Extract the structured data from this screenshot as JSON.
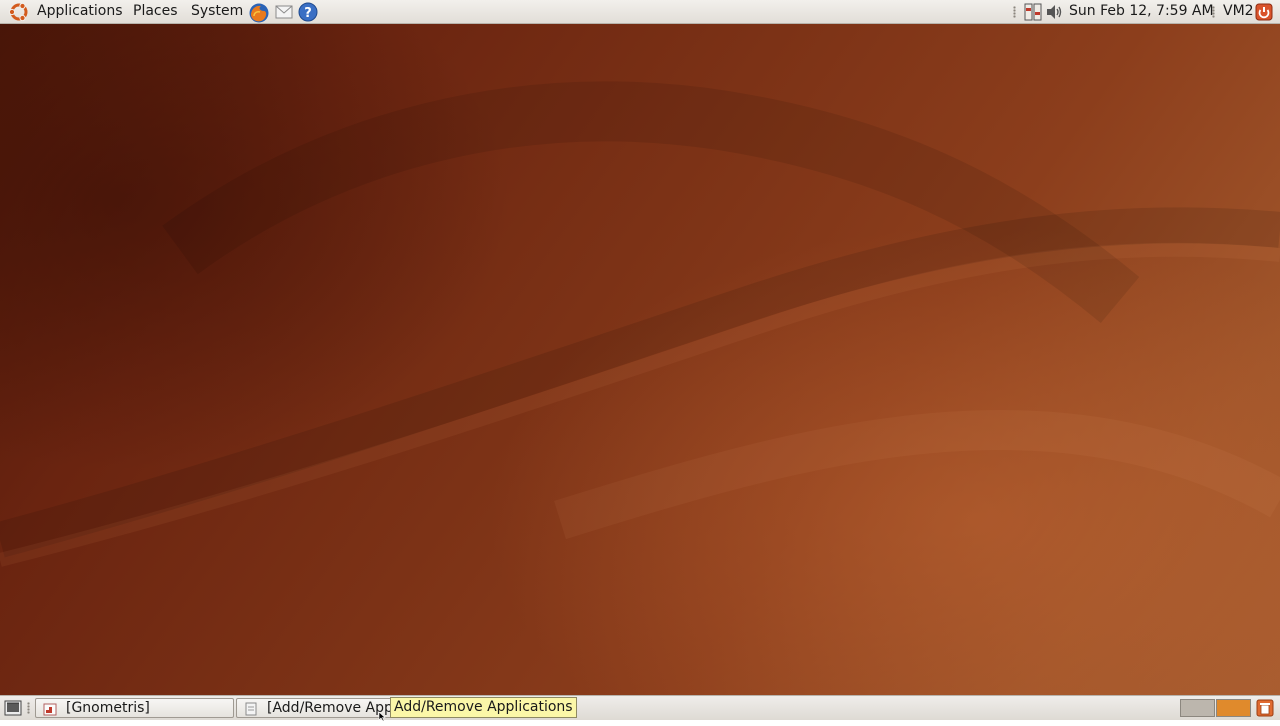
{
  "top_panel": {
    "menus": {
      "applications": "Applications",
      "places": "Places",
      "system": "System"
    },
    "launchers": [
      "firefox-icon",
      "mail-icon",
      "help-icon"
    ],
    "clock": "Sun Feb 12,  7:59 AM",
    "user": "VM2",
    "tray_icons": [
      "network-icon",
      "volume-icon",
      "power-icon"
    ]
  },
  "bottom_panel": {
    "tasks": [
      {
        "label": "[Gnometris]",
        "icon": "gnometris-icon"
      },
      {
        "label": "[Add/Remove Appli",
        "icon": "add-remove-icon"
      }
    ],
    "tooltip": "Add/Remove Applications",
    "workspaces": 2,
    "active_workspace": 2
  },
  "colors": {
    "panel": "#e8e5e0",
    "tooltip": "#fbf7a8",
    "workspace_active": "#e08a2c",
    "workspace_inactive": "#bcb6ad",
    "wallpaper": "#7c3216"
  }
}
